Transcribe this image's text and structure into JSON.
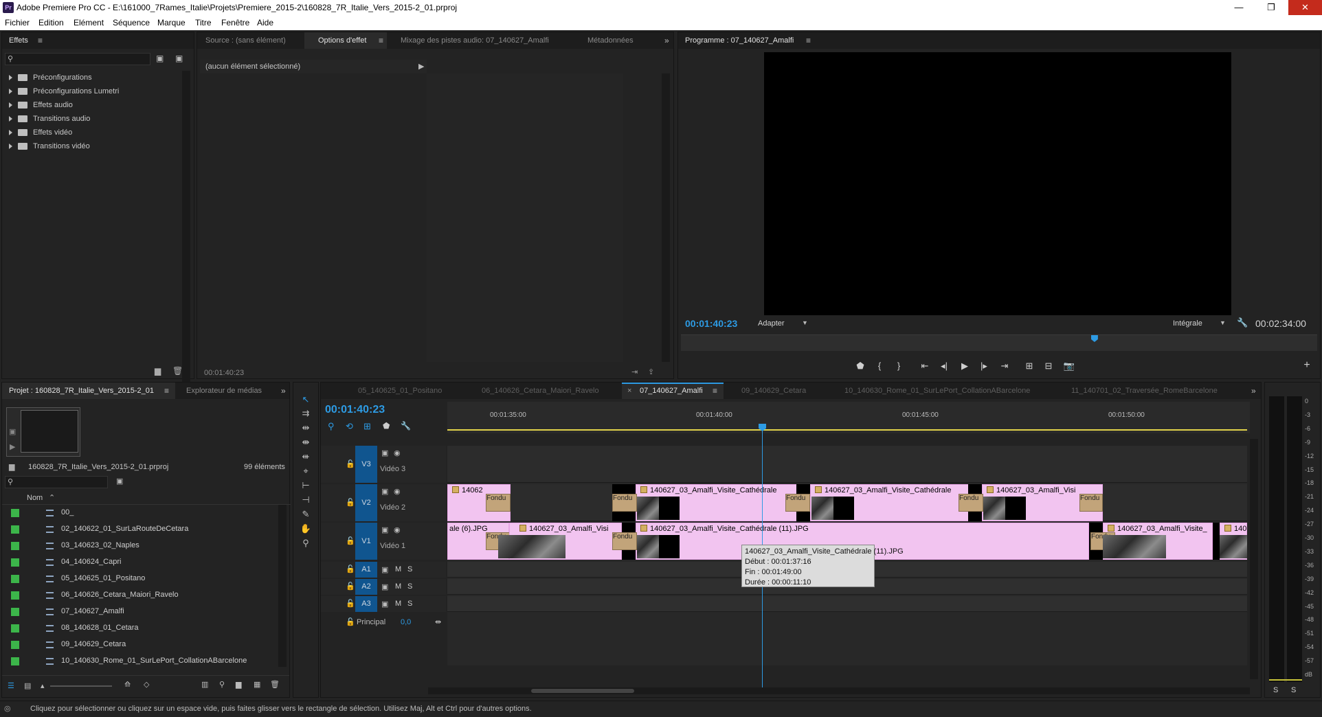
{
  "window": {
    "logo": "Pr",
    "title": "Adobe Premiere Pro CC - E:\\161000_7Rames_Italie\\Projets\\Premiere_2015-2\\160828_7R_Italie_Vers_2015-2_01.prproj",
    "buttons": {
      "minimize": "—",
      "maximize": "❐",
      "close": "✕"
    }
  },
  "menu": [
    "Fichier",
    "Edition",
    "Elément",
    "Séquence",
    "Marque",
    "Titre",
    "Fenêtre",
    "Aide"
  ],
  "effects_panel": {
    "tab": "Effets",
    "items": [
      "Préconfigurations",
      "Préconfigurations Lumetri",
      "Effets audio",
      "Transitions audio",
      "Effets vidéo",
      "Transitions vidéo"
    ]
  },
  "source_panel": {
    "tabs": [
      "Source : (sans élément)",
      "Options d'effet",
      "Mixage des pistes audio: 07_140627_Amalfi",
      "Métadonnées"
    ],
    "active_tab": "Options d'effet",
    "no_selection": "(aucun élément sélectionné)",
    "timecode": "00:01:40:23"
  },
  "program_monitor": {
    "tab": "Programme : 07_140627_Amalfi",
    "timecode": "00:01:40:23",
    "fit": "Adapter",
    "quality": "Intégrale",
    "duration": "00:02:34:00",
    "playhead_fraction": 0.65
  },
  "project_panel": {
    "tabs": [
      "Projet : 160828_7R_Italie_Vers_2015-2_01",
      "Explorateur de médias"
    ],
    "filename": "160828_7R_Italie_Vers_2015-2_01.prproj",
    "count": "99 éléments",
    "column_name": "Nom",
    "items": [
      "00_",
      "02_140622_01_SurLaRouteDeCetara",
      "03_140623_02_Naples",
      "04_140624_Capri",
      "05_140625_01_Positano",
      "06_140626_Cetara_Maiori_Ravelo",
      "07_140627_Amalfi",
      "08_140628_01_Cetara",
      "09_140629_Cetara",
      "10_140630_Rome_01_SurLePort_CollationABarcelone"
    ]
  },
  "timeline": {
    "tabs": [
      "05_140625_01_Positano",
      "06_140626_Cetara_Maiori_Ravelo",
      "07_140627_Amalfi",
      "09_140629_Cetara",
      "10_140630_Rome_01_SurLePort_CollationABarcelone",
      "11_140701_02_Traversée_RomeBarcelone"
    ],
    "active_tab": "07_140627_Amalfi",
    "timecode": "00:01:40:23",
    "ruler": [
      "00:01:35:00",
      "00:01:40:00",
      "00:01:45:00",
      "00:01:50:00"
    ],
    "tracks": {
      "v3": {
        "id": "V3",
        "name": "Vidéo 3"
      },
      "v2": {
        "id": "V2",
        "name": "Vidéo 2"
      },
      "v1": {
        "id": "V1",
        "name": "Vidéo 1"
      },
      "a1": {
        "id": "A1"
      },
      "a2": {
        "id": "A2"
      },
      "a3": {
        "id": "A3"
      },
      "master": {
        "name": "Principal",
        "value": "0,0"
      }
    },
    "track_buttons": {
      "mute": "M",
      "solo": "S"
    },
    "clips_v2": [
      "14062",
      "140627_03_Amalfi_Visite_Cathédrale",
      "140627_03_Amalfi_Visite_Cathédrale",
      "140627_03_Amalfi_Visi"
    ],
    "clips_v1": [
      "ale (6).JPG",
      "140627_03_Amalfi_Visi",
      "140627_03_Amalfi_Visite_Cathédrale (11).JPG",
      "140627_03_Amalfi_Visite_",
      "140"
    ],
    "transition_label": "Fondu",
    "tooltip": {
      "name": "140627_03_Amalfi_Visite_Cathédrale (11).JPG",
      "start": "Début : 00:01:37:16",
      "end": "Fin : 00:01:49:00",
      "duration": "Durée : 00:00:11:10"
    }
  },
  "audio_meter": {
    "scale": [
      "0",
      "-3",
      "-6",
      "-9",
      "-12",
      "-15",
      "-18",
      "-21",
      "-24",
      "-27",
      "-30",
      "-33",
      "-36",
      "-39",
      "-42",
      "-45",
      "-48",
      "-51",
      "-54",
      "-57",
      "dB"
    ],
    "solo_left": "S",
    "solo_right": "S"
  },
  "status_bar": "Cliquez pour sélectionner ou cliquez sur un espace vide, puis faites glisser vers le rectangle de sélection. Utilisez Maj, Alt et Ctrl pour d'autres options."
}
